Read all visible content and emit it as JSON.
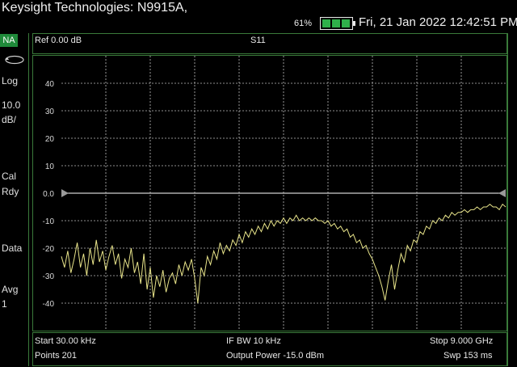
{
  "header": {
    "title": "Keysight Technologies: N9915A,",
    "battery_percent": "61%",
    "datetime": "Fri, 21 Jan 2022 12:42:51 PM"
  },
  "left_panel": {
    "mode": "NA",
    "format": "Log",
    "scale_value": "10.0",
    "scale_unit": "dB/",
    "cal_line1": "Cal",
    "cal_line2": "Rdy",
    "data_label": "Data",
    "avg_label": "Avg",
    "avg_value": "1"
  },
  "trace_header": {
    "reference": "Ref 0.00 dB",
    "trace_name": "S11"
  },
  "footer": {
    "start": "Start 30.00 kHz",
    "points": "Points 201",
    "if_bw": "IF BW 10 kHz",
    "output_power": "Output Power -15.0 dBm",
    "stop": "Stop 9.000 GHz",
    "sweep": "Swp 153 ms"
  },
  "colors": {
    "trace": "#e8e48a",
    "grid": "#bdbdbd",
    "border": "#3a7a3a",
    "mode_badge": "#1f8a3a",
    "reference_line": "#cfcfcf"
  },
  "chart_data": {
    "type": "line",
    "ylim": [
      -50,
      50
    ],
    "y_ticks": [
      "40",
      "30",
      "20",
      "10",
      "0.0",
      "-10",
      "-20",
      "-30",
      "-40"
    ],
    "reference_level": 0.0,
    "x_start_ghz": 3e-05,
    "x_stop_ghz": 9.0,
    "series": [
      {
        "values": [
          -23,
          -27,
          -21,
          -29,
          -24,
          -18,
          -27,
          -22,
          -30,
          -20,
          -26,
          -17,
          -25,
          -21,
          -28,
          -23,
          -19,
          -26,
          -22,
          -31,
          -24,
          -27,
          -20,
          -29,
          -25,
          -33,
          -22,
          -35,
          -27,
          -38,
          -30,
          -34,
          -28,
          -36,
          -31,
          -29,
          -33,
          -26,
          -30,
          -25,
          -28,
          -24,
          -31,
          -40,
          -27,
          -30,
          -23,
          -26,
          -21,
          -24,
          -18,
          -22,
          -19,
          -21,
          -17,
          -19,
          -15,
          -18,
          -14,
          -16,
          -13,
          -15,
          -12,
          -14,
          -11,
          -13,
          -10,
          -12,
          -10,
          -11,
          -9,
          -11,
          -9,
          -10,
          -8,
          -10,
          -9,
          -10,
          -9,
          -10,
          -9,
          -10,
          -10,
          -11,
          -10,
          -12,
          -11,
          -13,
          -12,
          -14,
          -13,
          -16,
          -15,
          -18,
          -17,
          -20,
          -19,
          -22,
          -24,
          -27,
          -30,
          -34,
          -39,
          -32,
          -26,
          -35,
          -28,
          -22,
          -25,
          -19,
          -21,
          -17,
          -18,
          -14,
          -15,
          -12,
          -13,
          -10,
          -11,
          -9,
          -10,
          -8,
          -9,
          -7,
          -8,
          -7,
          -7,
          -6,
          -7,
          -6,
          -6,
          -5,
          -6,
          -5,
          -5,
          -4,
          -5,
          -5,
          -6,
          -4,
          -5
        ]
      }
    ]
  }
}
